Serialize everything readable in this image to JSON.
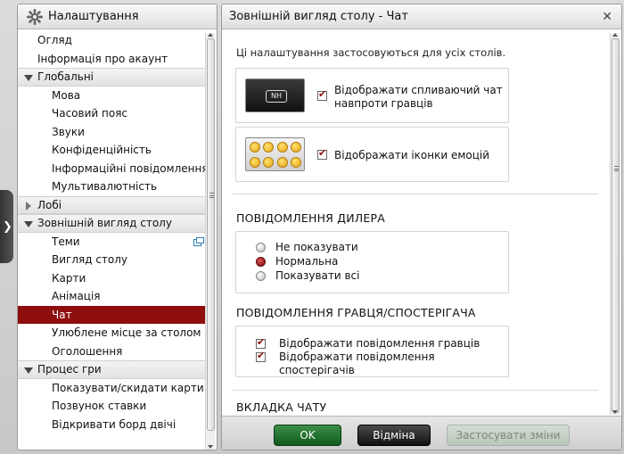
{
  "left_panel": {
    "title": "Налаштування",
    "items": [
      {
        "label": "Огляд",
        "kind": "lvl0"
      },
      {
        "label": "Інформація про акаунт",
        "kind": "lvl0"
      },
      {
        "label": "Глобальні",
        "kind": "section",
        "expanded": true
      },
      {
        "label": "Мова",
        "kind": "lvl1"
      },
      {
        "label": "Часовий пояс",
        "kind": "lvl1"
      },
      {
        "label": "Звуки",
        "kind": "lvl1"
      },
      {
        "label": "Конфіденційність",
        "kind": "lvl1"
      },
      {
        "label": "Інформаційні повідомлення",
        "kind": "lvl1"
      },
      {
        "label": "Мультивалютність",
        "kind": "lvl1"
      },
      {
        "label": "Лобі",
        "kind": "section",
        "expanded": false
      },
      {
        "label": "Зовнішній вигляд столу",
        "kind": "section",
        "expanded": true
      },
      {
        "label": "Теми",
        "kind": "lvl1",
        "external": true
      },
      {
        "label": "Вигляд столу",
        "kind": "lvl1"
      },
      {
        "label": "Карти",
        "kind": "lvl1"
      },
      {
        "label": "Анімація",
        "kind": "lvl1"
      },
      {
        "label": "Чат",
        "kind": "lvl1",
        "selected": true
      },
      {
        "label": "Улюблене місце за столом",
        "kind": "lvl1"
      },
      {
        "label": "Оголошення",
        "kind": "lvl1"
      },
      {
        "label": "Процес гри",
        "kind": "section",
        "expanded": true
      },
      {
        "label": "Показувати/скидати карти",
        "kind": "lvl1"
      },
      {
        "label": "Позвунок ставки",
        "kind": "lvl1"
      },
      {
        "label": "Відкривати борд двічі",
        "kind": "lvl1"
      }
    ]
  },
  "right_panel": {
    "title": "Зовнішній вигляд столу - Чат",
    "notice": "Ці налаштування застосовуються для усіх столів.",
    "preview_badge": "NH",
    "options": {
      "popup_chat": {
        "line1": "Відображати спливаючий чат",
        "line2": "навпроти гравців",
        "checked": true
      },
      "emotions": {
        "label": "Відображати іконки емоцій",
        "checked": true
      }
    },
    "dealer_section": {
      "title": "ПОВІДОМЛЕННЯ ДИЛЕРА",
      "choices": [
        "Не показувати",
        "Нормальна",
        "Показувати всі"
      ],
      "selected": 1
    },
    "player_section": {
      "title": "ПОВІДОМЛЕННЯ ГРАВЦЯ/СПОСТЕРІГАЧА",
      "show_players": "Відображати повідомлення гравців",
      "show_observers": "Відображати повідомлення спостерігачів"
    },
    "chat_tab_section": {
      "title": "ВКЛАДКА ЧАТУ"
    }
  },
  "footer": {
    "ok_label": "OK",
    "cancel_label": "Відміна",
    "apply_label": "Застосувати зміни"
  },
  "colors": {
    "accent": "#8e0d0d",
    "ok_button": "#1f6e2c",
    "cancel_button": "#2a2a2a"
  }
}
